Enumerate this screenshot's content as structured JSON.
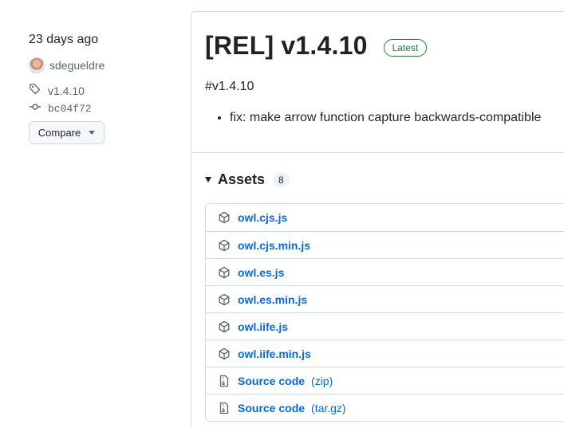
{
  "meta": {
    "date": "23 days ago",
    "author": "sdegueldre",
    "tag": "v1.4.10",
    "commit": "bc04f72",
    "compare_label": "Compare"
  },
  "release": {
    "title": "[REL] v1.4.10",
    "badge": "Latest",
    "tag_ref": "#v1.4.10",
    "notes": [
      "fix: make arrow function capture backwards-compatible"
    ]
  },
  "assets": {
    "title": "Assets",
    "count": "8",
    "items": [
      {
        "name": "owl.cjs.js",
        "ext": "",
        "icon": "package-icon"
      },
      {
        "name": "owl.cjs.min.js",
        "ext": "",
        "icon": "package-icon"
      },
      {
        "name": "owl.es.js",
        "ext": "",
        "icon": "package-icon"
      },
      {
        "name": "owl.es.min.js",
        "ext": "",
        "icon": "package-icon"
      },
      {
        "name": "owl.iife.js",
        "ext": "",
        "icon": "package-icon"
      },
      {
        "name": "owl.iife.min.js",
        "ext": "",
        "icon": "package-icon"
      },
      {
        "name": "Source code",
        "ext": "(zip)",
        "icon": "file-zip-icon"
      },
      {
        "name": "Source code",
        "ext": "(tar.gz)",
        "icon": "file-zip-icon"
      }
    ]
  },
  "colors": {
    "link": "#0969da",
    "badge_green": "#1a7f37",
    "border": "#d1d9e0",
    "muted": "#59636e"
  }
}
